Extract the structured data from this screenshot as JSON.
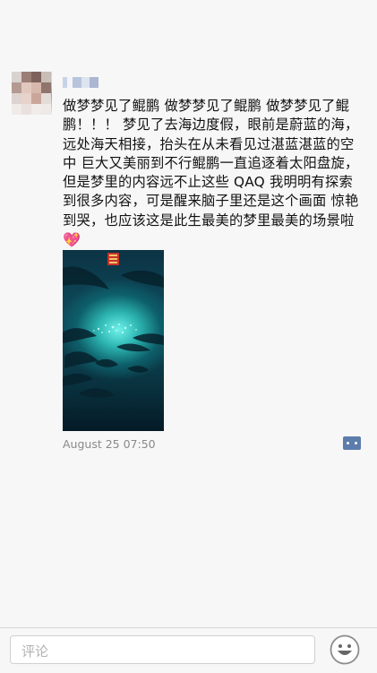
{
  "post": {
    "text": "做梦梦见了鲲鹏  做梦梦见了鲲鹏  做梦梦见了鲲鹏！！！ 梦见了去海边度假，眼前是蔚蓝的海，远处海天相接，抬头在从未看见过湛蓝湛蓝的空中  巨大又美丽到不行鲲鹏一直追逐着太阳盘旋，但是梦里的内容远不止这些 QAQ 我明明有探索到很多内容，可是醒来脑子里还是这个画面 惊艳到哭，也应该这是此生最美的梦里最美的场景啦",
    "emoji": "💖",
    "timestamp": "August 25 07:50"
  },
  "comment_bar": {
    "placeholder": "评论"
  },
  "icons": {
    "comment": "comment-dots-icon",
    "emoji": "smiley-face-icon"
  },
  "colors": {
    "background": "#f7f7f7",
    "comment_button": "#5c7dac",
    "timestamp": "#8a8a8a"
  }
}
